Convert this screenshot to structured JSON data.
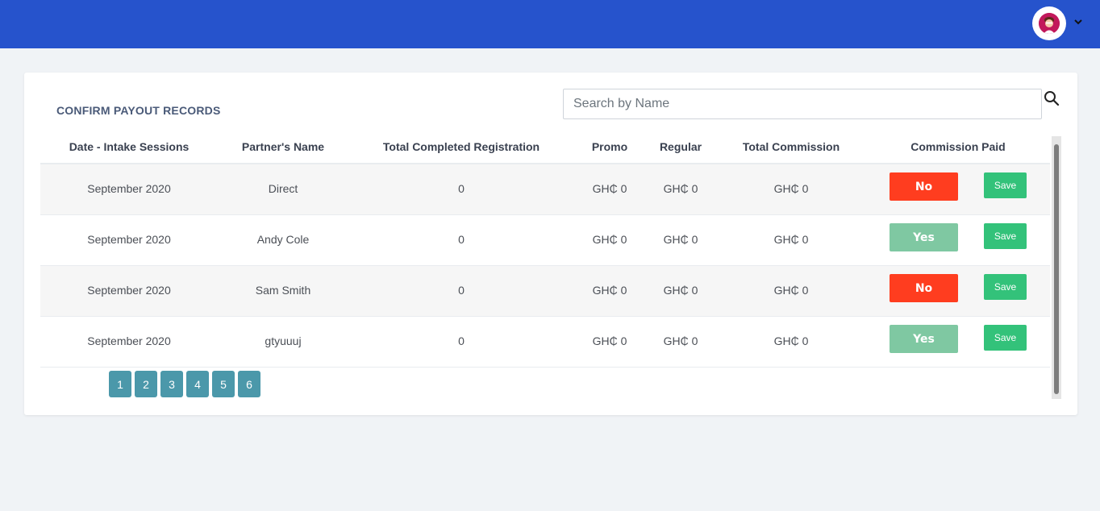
{
  "header": {
    "brand_color": "#2653cc",
    "avatar_icon": "user-avatar-icon",
    "menu_icon": "chevron-down-icon"
  },
  "card": {
    "title": "CONFIRM PAYOUT RECORDS",
    "search": {
      "placeholder": "Search by Name",
      "value": ""
    }
  },
  "table": {
    "columns": [
      "Date - Intake Sessions",
      "Partner's Name",
      "Total Completed Registration",
      "Promo",
      "Regular",
      "Total Commission",
      "Commission Paid"
    ],
    "rows": [
      {
        "date": "September 2020",
        "partner": "Direct",
        "total_registration": "0",
        "promo": "GH₵ 0",
        "regular": "GH₵ 0",
        "total_commission": "GH₵ 0",
        "paid": "No",
        "save": "Save"
      },
      {
        "date": "September 2020",
        "partner": "Andy Cole",
        "total_registration": "0",
        "promo": "GH₵ 0",
        "regular": "GH₵ 0",
        "total_commission": "GH₵ 0",
        "paid": "Yes",
        "save": "Save"
      },
      {
        "date": "September 2020",
        "partner": "Sam Smith",
        "total_registration": "0",
        "promo": "GH₵ 0",
        "regular": "GH₵ 0",
        "total_commission": "GH₵ 0",
        "paid": "No",
        "save": "Save"
      },
      {
        "date": "September 2020",
        "partner": "gtyuuuj",
        "total_registration": "0",
        "promo": "GH₵ 0",
        "regular": "GH₵ 0",
        "total_commission": "GH₵ 0",
        "paid": "Yes",
        "save": "Save"
      }
    ]
  },
  "pagination": {
    "pages": [
      "1",
      "2",
      "3",
      "4",
      "5",
      "6"
    ]
  },
  "colors": {
    "no_button": "#ff3d1f",
    "yes_button": "#7fc8a2",
    "save_button": "#33c27a",
    "page_button": "#4b98aa"
  }
}
